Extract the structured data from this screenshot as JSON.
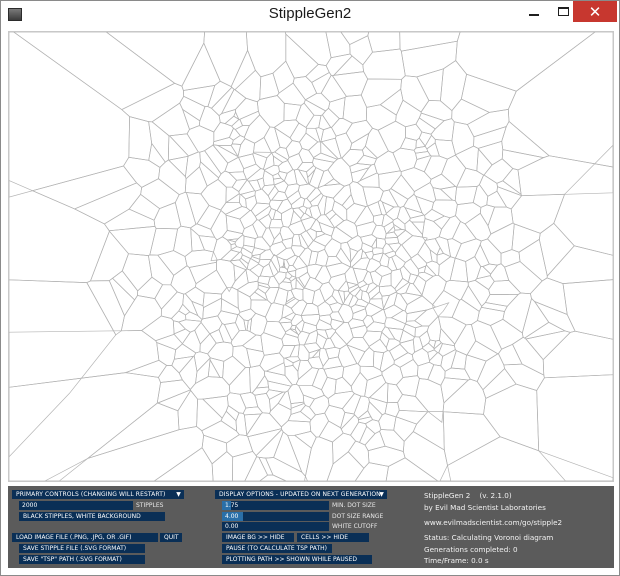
{
  "window": {
    "title": "StippleGen2",
    "close_glyph": "✕",
    "app_icon": "app-icon"
  },
  "primary": {
    "header": "PRIMARY CONTROLS (CHANGING WILL RESTART)",
    "stipples_value": "2000",
    "stipples_label": "STIPPLES",
    "color_toggle": "BLACK STIPPLES, WHITE BACKGROUND",
    "load_image": "LOAD IMAGE FILE (.PNG, .JPG, OR .GIF)",
    "quit": "QUIT",
    "save_svg": "SAVE STIPPLE FILE (.SVG FORMAT)",
    "save_tsp": "SAVE \"TSP\" PATH (.SVG FORMAT)"
  },
  "display": {
    "header": "DISPLAY OPTIONS - UPDATED ON NEXT GENERATION",
    "min_dot_value": "1.75",
    "min_dot_label": "MIN. DOT SIZE",
    "min_dot_fraction": 0.08,
    "dot_range_value": "4.00",
    "dot_range_label": "DOT SIZE RANGE",
    "dot_range_fraction": 0.2,
    "white_cutoff_value": "0.00",
    "white_cutoff_label": "WHITE CUTOFF",
    "white_cutoff_fraction": 0.0,
    "image_bg": "IMAGE BG >> HIDE",
    "cells": "CELLS >> HIDE",
    "pause": "PAUSE (TO CALCULATE TSP PATH)",
    "plotting_path": "PLOTTING PATH >> SHOWN WHILE PAUSED"
  },
  "info": {
    "name": "StippleGen 2",
    "version": "(v. 2.1.0)",
    "author": "by Evil Mad Scientist Laboratories",
    "url": "www.evilmadscientist.com/go/stipple2",
    "status": "Status: Calculating Voronoi diagram",
    "generations": "Generations completed: 0",
    "time_frame": "Time/Frame: 0.0 s"
  },
  "colors": {
    "panel_bg": "#5b5b5b",
    "control_bg": "#0a2f56",
    "slider_fill": "#2a6fa8",
    "cell_lines": "#b4b4b4",
    "close_button": "#c7372f"
  }
}
